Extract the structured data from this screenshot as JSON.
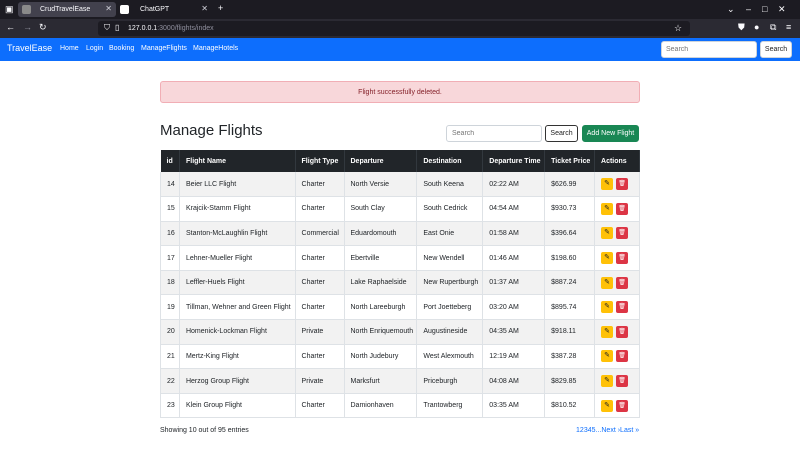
{
  "browser": {
    "tabs": [
      {
        "title": "CrudTravelEase",
        "active": true
      },
      {
        "title": "ChatGPT",
        "active": false
      }
    ],
    "new_tab": "+",
    "url_host": "127.0.0.1",
    "url_path": ":3000/flights/index"
  },
  "navbar": {
    "brand": "TravelEase",
    "links": [
      "Home",
      "Login",
      "Booking",
      "ManageFlights",
      "ManageHotels"
    ],
    "search_placeholder": "Search",
    "search_button": "Search",
    "bg_color": "#0d6efd"
  },
  "alert": {
    "message": "Flight successfully deleted."
  },
  "page": {
    "title": "Manage Flights",
    "search_placeholder": "Search",
    "search_button": "Search",
    "add_button": "Add New Flight"
  },
  "table": {
    "columns": [
      "id",
      "Flight Name",
      "Flight Type",
      "Departure",
      "Destination",
      "Departure Time",
      "Ticket Price",
      "Actions"
    ],
    "rows": [
      [
        "14",
        "Beier LLC Flight",
        "Charter",
        "North Versie",
        "South Keena",
        "02:22 AM",
        "$626.99"
      ],
      [
        "15",
        "Krajcik-Stamm Flight",
        "Charter",
        "South Clay",
        "South Cedrick",
        "04:54 AM",
        "$930.73"
      ],
      [
        "16",
        "Stanton-McLaughlin Flight",
        "Commercial",
        "Eduardomouth",
        "East Onie",
        "01:58 AM",
        "$396.64"
      ],
      [
        "17",
        "Lehner-Mueller Flight",
        "Charter",
        "Ebertville",
        "New Wendell",
        "01:46 AM",
        "$198.60"
      ],
      [
        "18",
        "Leffler-Huels Flight",
        "Charter",
        "Lake Raphaelside",
        "New Rupertburgh",
        "01:37 AM",
        "$887.24"
      ],
      [
        "19",
        "Tillman, Wehner and Green Flight",
        "Charter",
        "North Lareeburgh",
        "Port Joetteberg",
        "03:20 AM",
        "$895.74"
      ],
      [
        "20",
        "Homenick-Lockman Flight",
        "Private",
        "North Enriquemouth",
        "Augustineside",
        "04:35 AM",
        "$918.11"
      ],
      [
        "21",
        "Mertz-King Flight",
        "Charter",
        "North Judebury",
        "West Alexmouth",
        "12:19 AM",
        "$387.28"
      ],
      [
        "22",
        "Herzog Group Flight",
        "Private",
        "Marksfurt",
        "Priceburgh",
        "04:08 AM",
        "$829.85"
      ],
      [
        "23",
        "Klein Group Flight",
        "Charter",
        "Damionhaven",
        "Trantowberg",
        "03:35 AM",
        "$810.52"
      ]
    ],
    "edit_icon": "edit-icon",
    "delete_icon": "trash-icon"
  },
  "footer": {
    "entries_text": "Showing 10 out of 95 entries",
    "pages": [
      "1",
      "2",
      "3",
      "4",
      "5",
      "...",
      "Next ›",
      "Last »"
    ]
  }
}
